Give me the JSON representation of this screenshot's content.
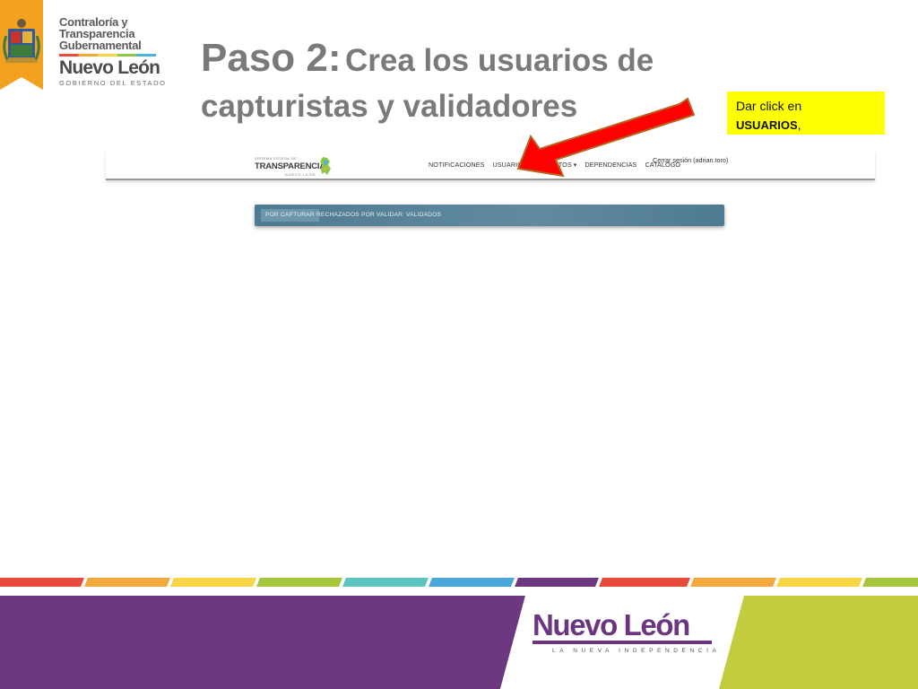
{
  "branding": {
    "logo_lines": [
      "Contraloría y",
      "Transparencia",
      "Gubernamental"
    ],
    "logo_state": "Nuevo León",
    "logo_gov": "GOBIERNO DEL ESTADO",
    "ribbon_color": "#f3a21f"
  },
  "title": {
    "step": "Paso 2:",
    "line1_rest": "Crea los usuarios de",
    "line2": "capturistas y validadores"
  },
  "note": {
    "text": "Dar click en",
    "bold": "USUARIOS",
    "suffix": ","
  },
  "app": {
    "logo_small": "SISTEMA ESTATAL DE",
    "logo_name": "TRANSPARENCIA",
    "logo_sub": "NUEVO LEÓN",
    "nav": [
      "NOTIFICACIONES",
      "USUARIOS",
      "FORMATOS ▾",
      "DEPENDENCIAS",
      "CATALOGO"
    ],
    "logout": "Cerrar sesión (adrian.toro)",
    "tabs": [
      "POR CAPTURAR",
      "RECHAZADOS",
      "POR VALIDAR",
      "VALIDADOS"
    ],
    "tab_color": "#557f95"
  },
  "footer": {
    "brand": "Nuevo León",
    "tagline": "LA NUEVA INDEPENDENCIA",
    "colors": {
      "purple": "#6e3880",
      "green": "#c3cc3e"
    }
  },
  "annotation": {
    "arrow_color": "#ff0000"
  }
}
